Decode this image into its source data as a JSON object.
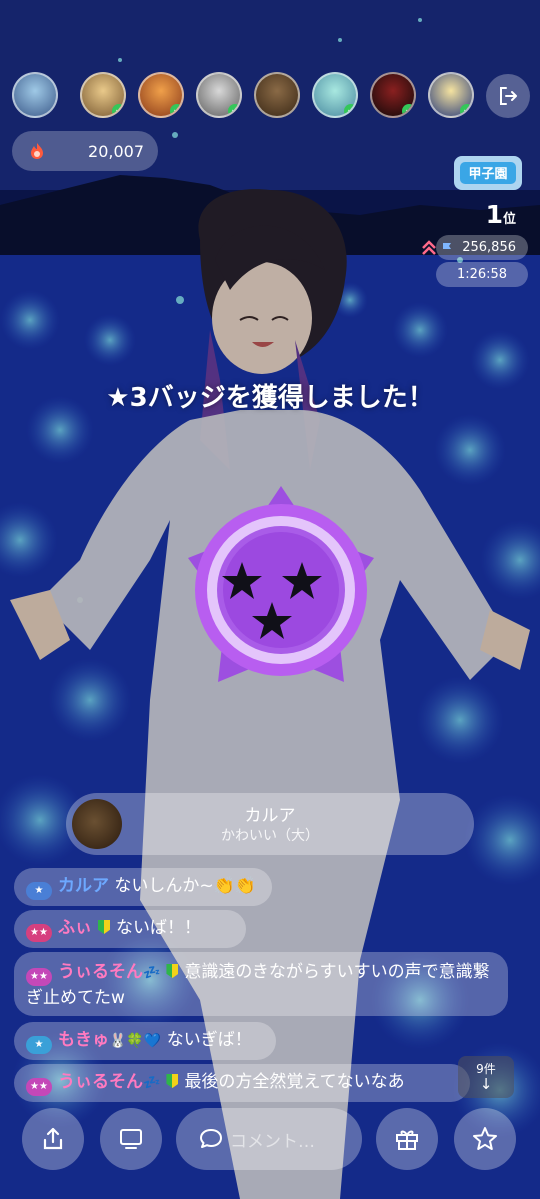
{
  "top": {
    "viewer_avatars": [
      {
        "name": "viewer-1",
        "verified": false
      },
      {
        "name": "viewer-2",
        "verified": true
      },
      {
        "name": "viewer-3",
        "verified": true
      },
      {
        "name": "viewer-4",
        "verified": true
      },
      {
        "name": "viewer-5",
        "verified": false
      },
      {
        "name": "viewer-6",
        "verified": true
      },
      {
        "name": "viewer-7",
        "verified": true
      },
      {
        "name": "viewer-8",
        "verified": true
      }
    ],
    "exit_icon": "exit-icon"
  },
  "points": {
    "value": "20,007",
    "icon": "fire-icon"
  },
  "ranking": {
    "event_logo_text": "甲子園",
    "rank": "1",
    "rank_suffix": "位",
    "score": "256,856",
    "timer": "1:26:58"
  },
  "badge_notice": "★3バッジを獲得しました！",
  "gift_card": {
    "name": "カルア",
    "subtitle": "かわいい（大）"
  },
  "comments": [
    {
      "badge": "★",
      "badge_color": "#4a7fd6",
      "user": "カルア",
      "user_color": "blue",
      "beginner": false,
      "suffix": "",
      "text": "ないしんか~👏👏"
    },
    {
      "badge": "★★",
      "badge_color": "#d6407f",
      "user": "ふぃ",
      "user_color": "pink",
      "beginner": true,
      "suffix": "",
      "text": "ないば！！"
    },
    {
      "badge": "★★",
      "badge_color": "#c448b8",
      "user": "うぃるそん",
      "user_color": "pink",
      "beginner": true,
      "suffix": "💤",
      "text": "意識遠のきながらすいすいの声で意識繋ぎ止めてたw"
    },
    {
      "badge": "★",
      "badge_color": "#3aa0d8",
      "user": "もきゅ",
      "user_color": "pink",
      "beginner": false,
      "suffix": "🐰🍀💙",
      "text": "ないぎば！"
    },
    {
      "badge": "★★",
      "badge_color": "#c448b8",
      "user": "うぃるそん",
      "user_color": "pink",
      "beginner": true,
      "suffix": "💤",
      "text": "最後の方全然覚えてないなあ"
    }
  ],
  "unread": {
    "label": "9件",
    "arrow": "↓"
  },
  "bottom_bar": {
    "share_icon": "share-icon",
    "screen_icon": "screen-icon",
    "comment_placeholder": "コメント…",
    "gift_icon": "gift-icon",
    "star_icon": "star-icon"
  }
}
